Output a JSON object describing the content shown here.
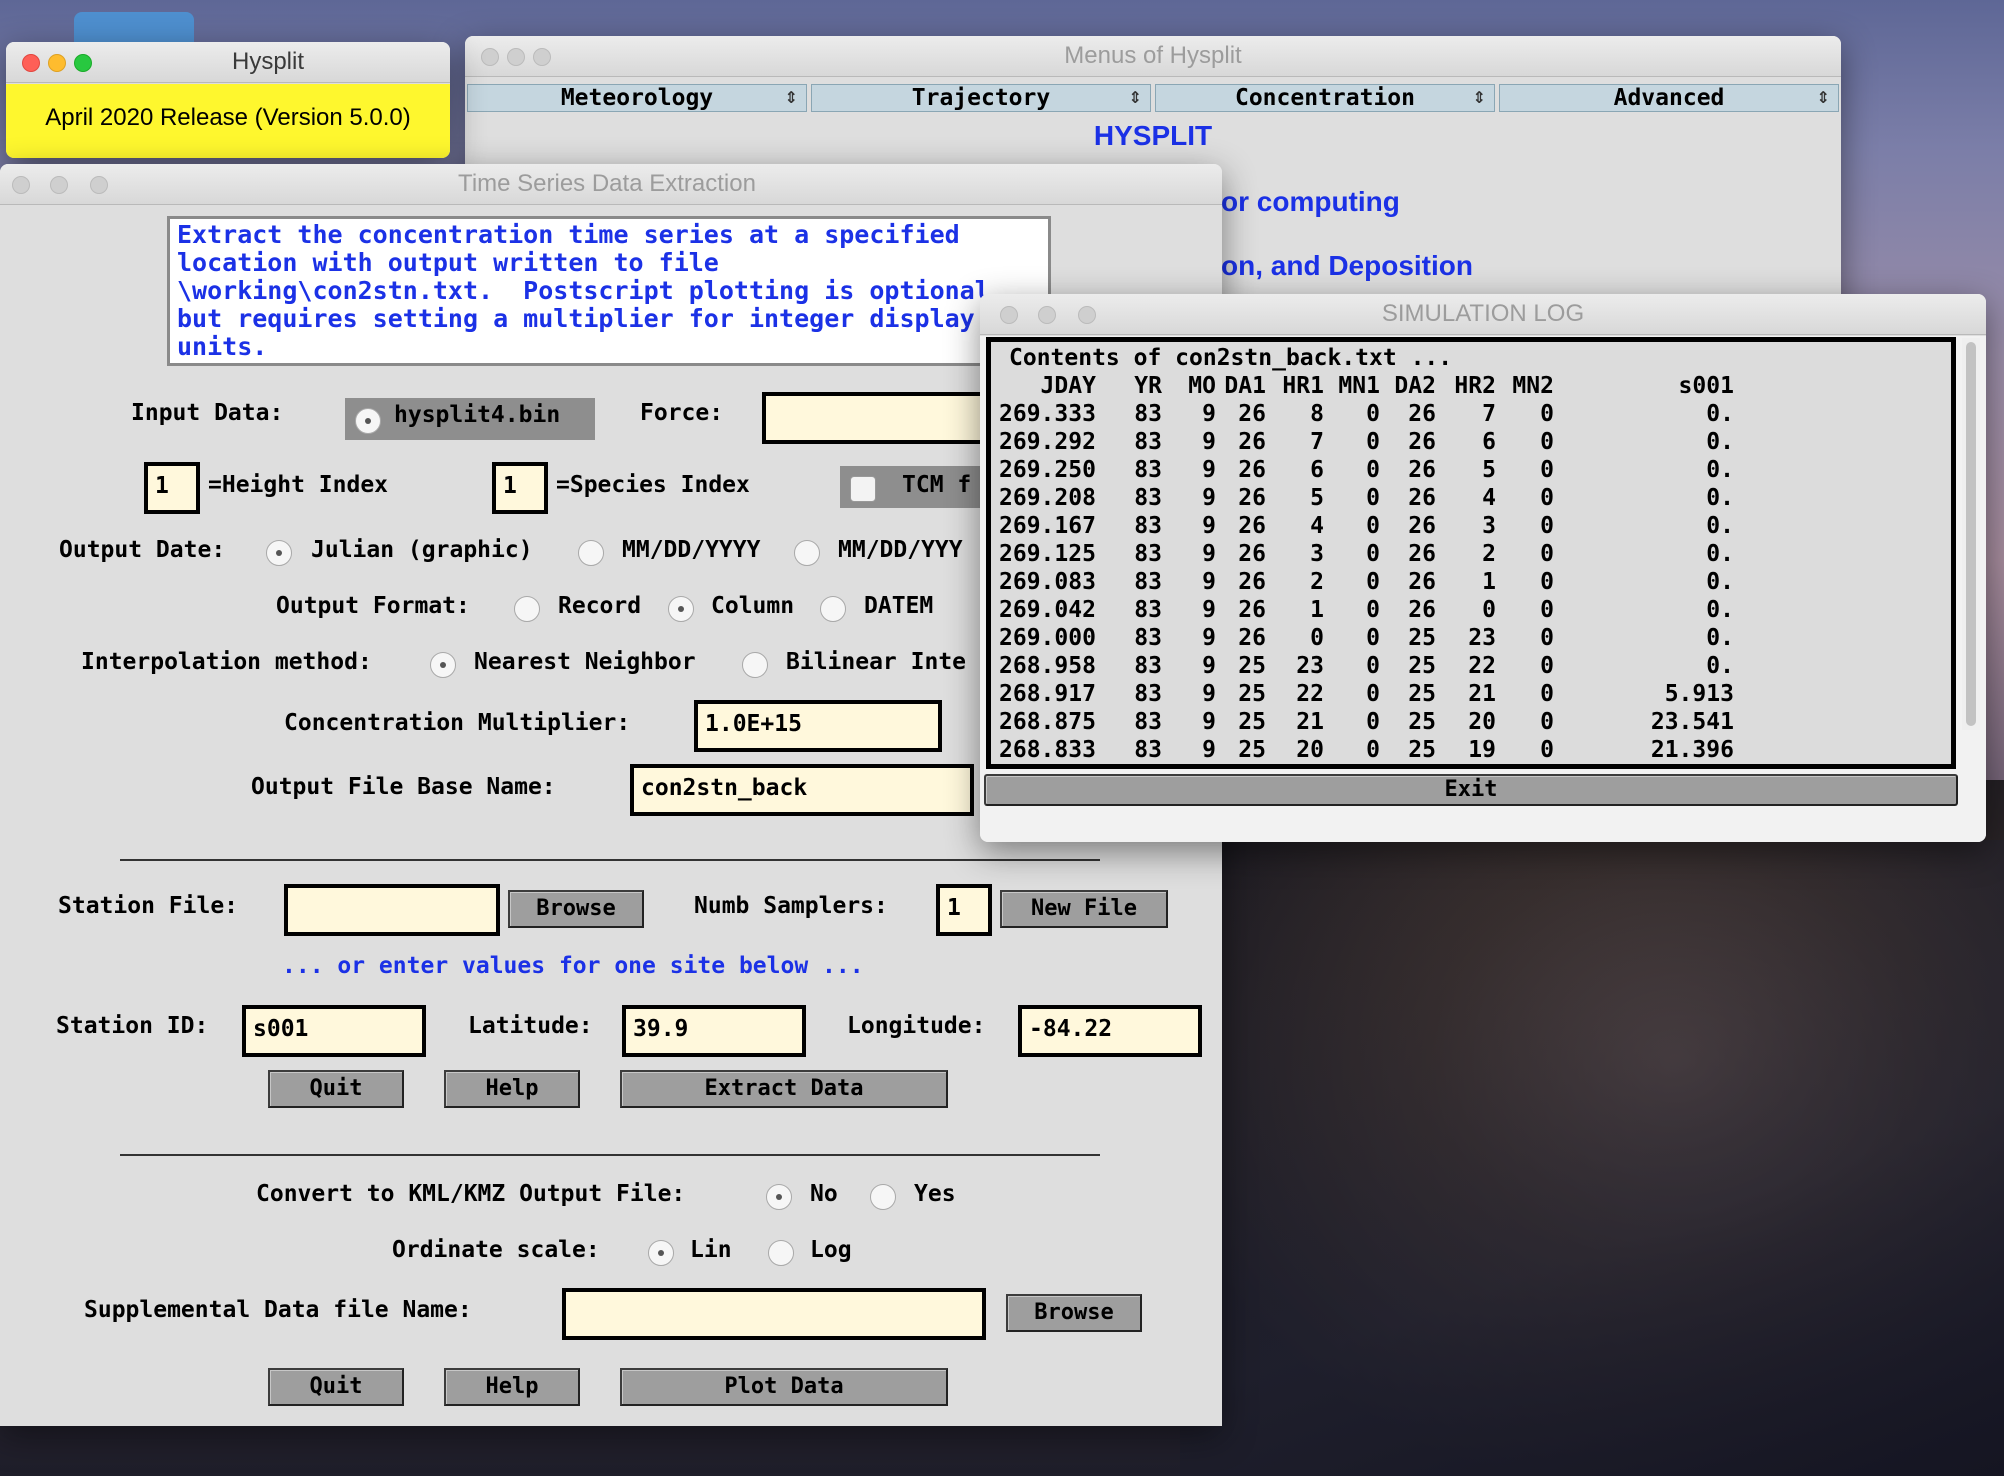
{
  "hysplit_window": {
    "title": "Hysplit",
    "release": "April 2020 Release (Version 5.0.0)"
  },
  "menus_window": {
    "title": "Menus of Hysplit",
    "menu": [
      "Meteorology",
      "Trajectory",
      "Concentration",
      "Advanced"
    ],
    "heading": "HYSPLIT",
    "line1": "or computing",
    "line2": "on, and Deposition"
  },
  "ts_window": {
    "title": "Time Series Data Extraction",
    "description": [
      "Extract the concentration time series at a specified",
      "location with output written to file",
      "\\working\\con2stn.txt.  Postscript plotting is optional",
      "but requires setting a multiplier for integer display",
      "units."
    ],
    "input_data_label": "Input Data:",
    "input_data_value": "hysplit4.bin",
    "force_label": "Force:",
    "force_value": "",
    "height_index": "1",
    "height_index_label": "=Height Index",
    "species_index": "1",
    "species_index_label": "=Species Index",
    "tcm_label": "TCM f",
    "output_date_label": "Output Date:",
    "output_date_options": [
      "Julian (graphic)",
      "MM/DD/YYYY",
      "MM/DD/YYY"
    ],
    "output_format_label": "Output Format:",
    "output_format_options": [
      "Record",
      "Column",
      "DATEM"
    ],
    "interp_label": "Interpolation method:",
    "interp_options": [
      "Nearest Neighbor",
      "Bilinear Inte"
    ],
    "conc_mult_label": "Concentration Multiplier:",
    "conc_mult_value": "1.0E+15",
    "base_name_label": "Output File Base Name:",
    "base_name_value": "con2stn_back",
    "station_file_label": "Station File:",
    "station_file_value": "",
    "browse_label": "Browse",
    "numb_samplers_label": "Numb Samplers:",
    "numb_samplers_value": "1",
    "new_file_label": "New File",
    "or_enter": "... or enter values for one site below ...",
    "station_id_label": "Station ID:",
    "station_id_value": "s001",
    "latitude_label": "Latitude:",
    "latitude_value": "39.9",
    "longitude_label": "Longitude:",
    "longitude_value": "-84.22",
    "quit_label": "Quit",
    "help_label": "Help",
    "extract_label": "Extract Data",
    "kml_label": "Convert to KML/KMZ Output File:",
    "kml_options": [
      "No",
      "Yes"
    ],
    "ordinate_label": "Ordinate scale:",
    "ordinate_options": [
      "Lin",
      "Log"
    ],
    "supp_label": "Supplemental Data file Name:",
    "supp_value": "",
    "browse2_label": "Browse",
    "quit2_label": "Quit",
    "help2_label": "Help",
    "plot_label": "Plot Data"
  },
  "log_window": {
    "title": "SIMULATION LOG",
    "header_line": "Contents of con2stn_back.txt ...",
    "columns": [
      "JDAY",
      "YR",
      "MO",
      "DA1",
      "HR1",
      "MN1",
      "DA2",
      "HR2",
      "MN2",
      "s001"
    ],
    "rows": [
      [
        "269.333",
        "83",
        "9",
        "26",
        "8",
        "0",
        "26",
        "7",
        "0",
        "0."
      ],
      [
        "269.292",
        "83",
        "9",
        "26",
        "7",
        "0",
        "26",
        "6",
        "0",
        "0."
      ],
      [
        "269.250",
        "83",
        "9",
        "26",
        "6",
        "0",
        "26",
        "5",
        "0",
        "0."
      ],
      [
        "269.208",
        "83",
        "9",
        "26",
        "5",
        "0",
        "26",
        "4",
        "0",
        "0."
      ],
      [
        "269.167",
        "83",
        "9",
        "26",
        "4",
        "0",
        "26",
        "3",
        "0",
        "0."
      ],
      [
        "269.125",
        "83",
        "9",
        "26",
        "3",
        "0",
        "26",
        "2",
        "0",
        "0."
      ],
      [
        "269.083",
        "83",
        "9",
        "26",
        "2",
        "0",
        "26",
        "1",
        "0",
        "0."
      ],
      [
        "269.042",
        "83",
        "9",
        "26",
        "1",
        "0",
        "26",
        "0",
        "0",
        "0."
      ],
      [
        "269.000",
        "83",
        "9",
        "26",
        "0",
        "0",
        "25",
        "23",
        "0",
        "0."
      ],
      [
        "268.958",
        "83",
        "9",
        "25",
        "23",
        "0",
        "25",
        "22",
        "0",
        "0."
      ],
      [
        "268.917",
        "83",
        "9",
        "25",
        "22",
        "0",
        "25",
        "21",
        "0",
        "5.913"
      ],
      [
        "268.875",
        "83",
        "9",
        "25",
        "21",
        "0",
        "25",
        "20",
        "0",
        "23.541"
      ],
      [
        "268.833",
        "83",
        "9",
        "25",
        "20",
        "0",
        "25",
        "19",
        "0",
        "21.396"
      ]
    ],
    "exit_label": "Exit"
  }
}
